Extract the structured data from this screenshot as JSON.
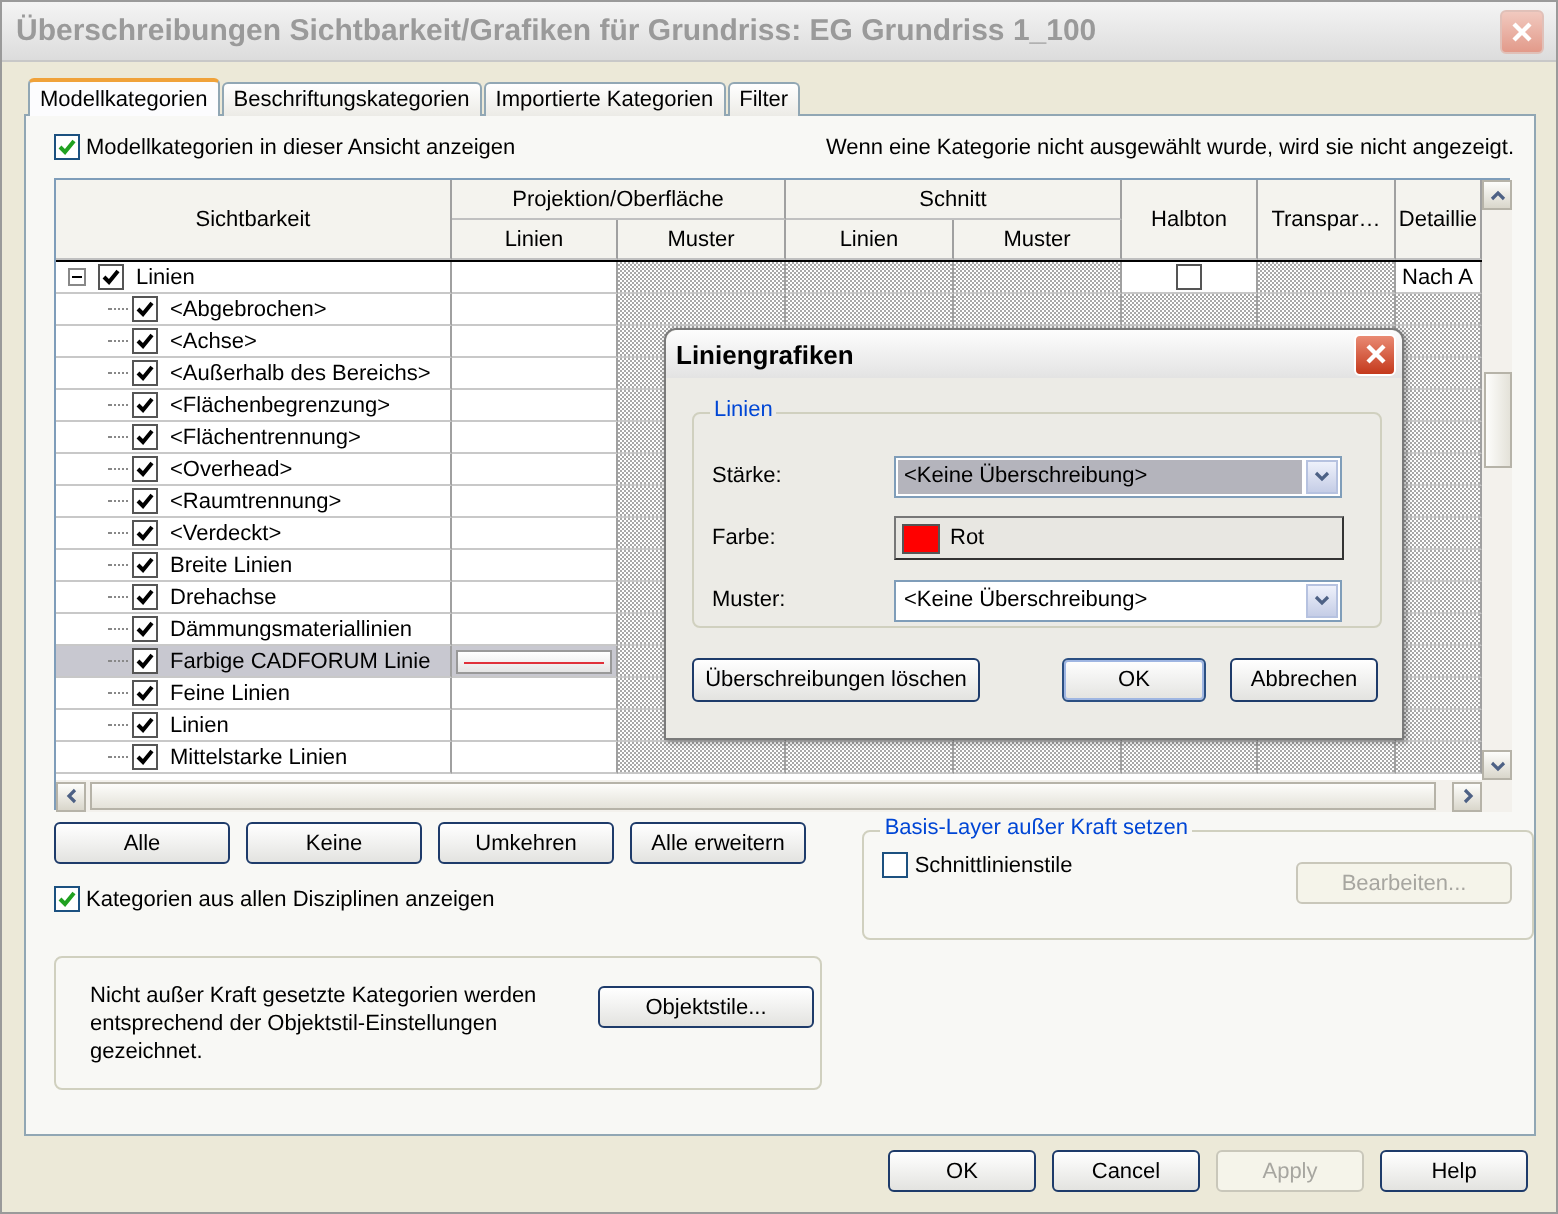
{
  "window": {
    "title": "Überschreibungen Sichtbarkeit/Grafiken für Grundriss: EG Grundriss 1_100"
  },
  "tabs": [
    {
      "label": "Modellkategorien",
      "selected": true
    },
    {
      "label": "Beschriftungskategorien",
      "selected": false
    },
    {
      "label": "Importierte Kategorien",
      "selected": false
    },
    {
      "label": "Filter",
      "selected": false
    }
  ],
  "show_categories": {
    "label": "Modellkategorien in dieser Ansicht anzeigen",
    "checked": true
  },
  "hint": "Wenn eine Kategorie nicht ausgewählt wurde, wird sie nicht angezeigt.",
  "table": {
    "column_groups": [
      {
        "label": "Sichtbarkeit"
      },
      {
        "label": "Projektion/Oberfläche",
        "columns": [
          "Linien",
          "Muster"
        ]
      },
      {
        "label": "Schnitt",
        "columns": [
          "Linien",
          "Muster"
        ]
      },
      {
        "label": "Halbton"
      },
      {
        "label": "Transpar…"
      },
      {
        "label": "Detaillie"
      }
    ],
    "rows": [
      {
        "name": "Linien",
        "checked": true,
        "expanded": true,
        "halbton_checked": false,
        "detail": "Nach A",
        "children": [
          {
            "name": "<Abgebrochen>",
            "checked": true,
            "selected": false,
            "line_override": false
          },
          {
            "name": "<Achse>",
            "checked": true,
            "selected": false,
            "line_override": false
          },
          {
            "name": "<Außerhalb des Bereichs>",
            "checked": true,
            "selected": false,
            "line_override": false
          },
          {
            "name": "<Flächenbegrenzung>",
            "checked": true,
            "selected": false,
            "line_override": false
          },
          {
            "name": "<Flächentrennung>",
            "checked": true,
            "selected": false,
            "line_override": false
          },
          {
            "name": "<Overhead>",
            "checked": true,
            "selected": false,
            "line_override": false
          },
          {
            "name": "<Raumtrennung>",
            "checked": true,
            "selected": false,
            "line_override": false
          },
          {
            "name": "<Verdeckt>",
            "checked": true,
            "selected": false,
            "line_override": false
          },
          {
            "name": "Breite Linien",
            "checked": true,
            "selected": false,
            "line_override": false
          },
          {
            "name": "Drehachse",
            "checked": true,
            "selected": false,
            "line_override": false
          },
          {
            "name": "Dämmungsmateriallinien",
            "checked": true,
            "selected": false,
            "line_override": false
          },
          {
            "name": "Farbige CADFORUM Linie",
            "checked": true,
            "selected": true,
            "line_override": true
          },
          {
            "name": "Feine Linien",
            "checked": true,
            "selected": false,
            "line_override": false
          },
          {
            "name": "Linien",
            "checked": true,
            "selected": false,
            "line_override": false
          },
          {
            "name": "Mittelstarke Linien",
            "checked": true,
            "selected": false,
            "line_override": false
          }
        ]
      }
    ]
  },
  "tree_buttons": [
    {
      "label": "Alle",
      "disabled": false
    },
    {
      "label": "Keine",
      "disabled": false
    },
    {
      "label": "Umkehren",
      "disabled": false
    },
    {
      "label": "Alle erweitern",
      "disabled": false
    }
  ],
  "all_disciplines": {
    "label": "Kategorien aus allen Disziplinen anzeigen",
    "checked": true
  },
  "base_layer": {
    "title": "Basis-Layer außer Kraft setzen",
    "checkbox": {
      "label": "Schnittlinienstile",
      "checked": false
    },
    "button": {
      "label": "Bearbeiten...",
      "disabled": true
    }
  },
  "info": {
    "text": "Nicht außer Kraft gesetzte Kategorien werden entsprechend der Objektstil-Einstellungen gezeichnet.",
    "button": "Objektstile..."
  },
  "dialog_buttons": [
    {
      "label": "OK",
      "disabled": false
    },
    {
      "label": "Cancel",
      "disabled": false
    },
    {
      "label": "Apply",
      "disabled": true
    },
    {
      "label": "Help",
      "disabled": false
    }
  ],
  "line_dialog": {
    "title": "Liniengrafiken",
    "group": "Linien",
    "fields": [
      {
        "kind": "dropdown",
        "label": "Stärke:",
        "value": "<Keine Überschreibung>",
        "focused": true
      },
      {
        "kind": "color",
        "label": "Farbe:",
        "value": "Rot",
        "color": "#ff0000"
      },
      {
        "kind": "dropdown",
        "label": "Muster:",
        "value": "<Keine Überschreibung>",
        "focused": false
      }
    ],
    "buttons": [
      {
        "label": "Überschreibungen löschen",
        "default": false
      },
      {
        "label": "OK",
        "default": true
      },
      {
        "label": "Abbrechen",
        "default": false
      }
    ]
  }
}
